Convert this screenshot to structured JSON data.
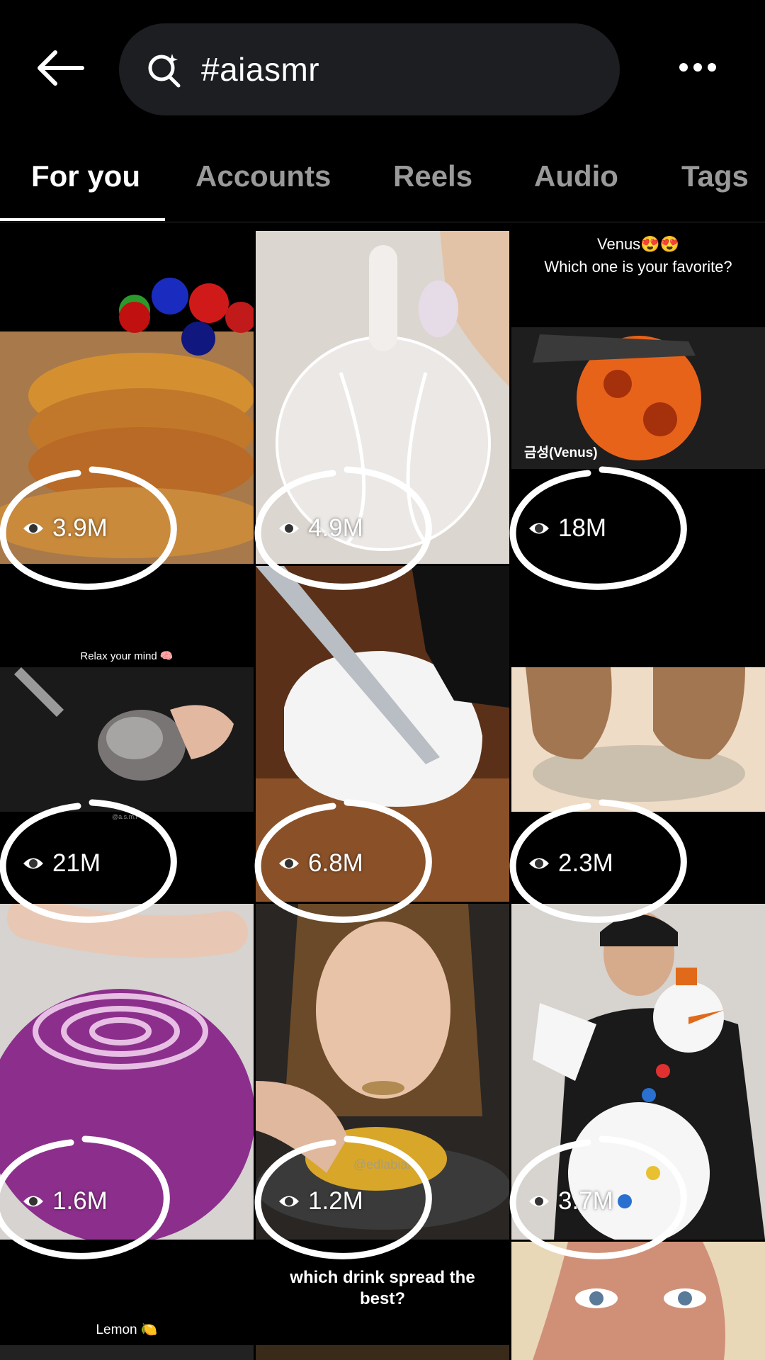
{
  "search": {
    "query": "#aiasmr"
  },
  "tabs": [
    {
      "label": "For you",
      "active": true
    },
    {
      "label": "Accounts",
      "active": false
    },
    {
      "label": "Reels",
      "active": false
    },
    {
      "label": "Audio",
      "active": false
    },
    {
      "label": "Tags",
      "active": false
    }
  ],
  "tiles": [
    {
      "views": "3.9M"
    },
    {
      "views": "4.9M"
    },
    {
      "views": "18M",
      "caption_line1": "Venus😍😍",
      "caption_line2": "Which one is your favorite?",
      "label": "금성(Venus)"
    },
    {
      "views": "21M",
      "caption": "Relax your mind 🧠",
      "watermark": "@a.s.m.r"
    },
    {
      "views": "6.8M"
    },
    {
      "views": "2.3M"
    },
    {
      "views": "1.6M"
    },
    {
      "views": "1.2M",
      "watermark": "@edlabian"
    },
    {
      "views": "3.7M"
    },
    {
      "caption": "Lemon 🍋"
    },
    {
      "caption": "which drink spread the best?"
    },
    {}
  ],
  "colors": {
    "accent": "#ffffff",
    "search_bg": "#1c1e22",
    "inactive_tab": "#9a9a9a"
  }
}
